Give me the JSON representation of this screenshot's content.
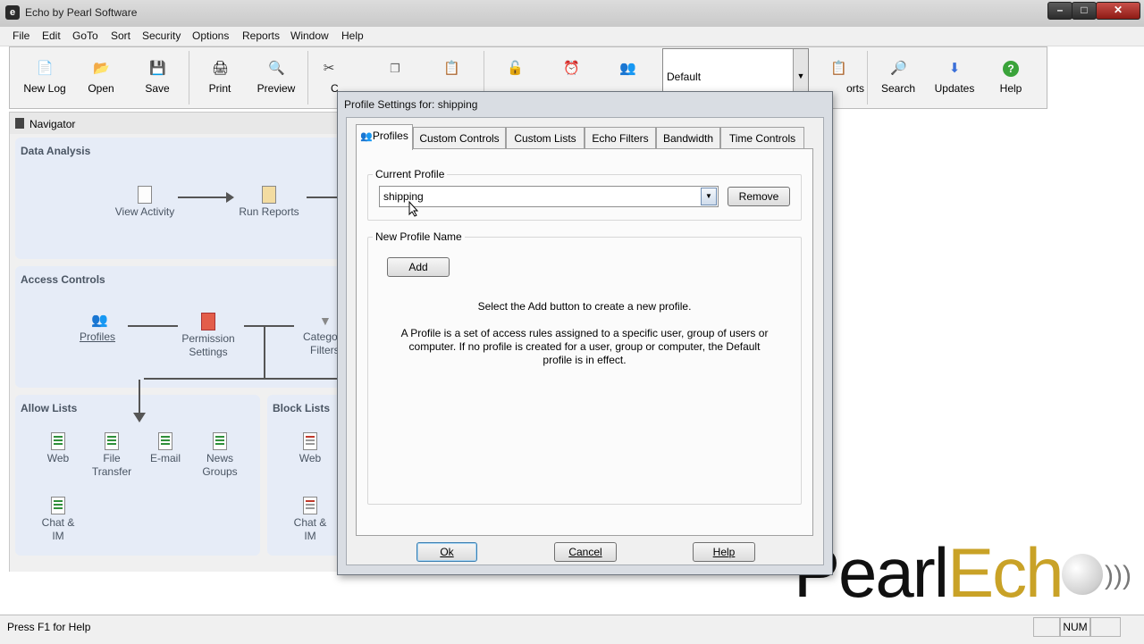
{
  "window": {
    "title": "Echo by Pearl Software",
    "app_icon_glyph": "e",
    "controls": [
      "–",
      "□",
      "✕"
    ]
  },
  "menu": [
    "File",
    "Edit",
    "GoTo",
    "Sort",
    "Security",
    "Options",
    "Reports",
    "Window",
    "Help"
  ],
  "toolbar": {
    "new_log": "New Log",
    "open": "Open",
    "save": "Save",
    "print": "Print",
    "preview": "Preview",
    "cut_partial": "C",
    "profile_combo_value": "Default",
    "reports_partial": "orts",
    "search": "Search",
    "updates": "Updates",
    "help": "Help"
  },
  "navigator": {
    "title": "Navigator",
    "data_analysis": {
      "title": "Data Analysis",
      "view_activity": "View Activity",
      "run_reports": "Run Reports"
    },
    "access_controls": {
      "title": "Access Controls",
      "profiles": "Profiles",
      "permission_settings_1": "Permission",
      "permission_settings_2": "Settings",
      "category_filters_1": "Categor",
      "category_filters_2": "Filters"
    },
    "allow_lists": {
      "title": "Allow Lists",
      "web": "Web",
      "file_transfer_1": "File",
      "file_transfer_2": "Transfer",
      "email": "E-mail",
      "news_groups_1": "News",
      "news_groups_2": "Groups",
      "chat_im_1": "Chat &",
      "chat_im_2": "IM"
    },
    "block_lists": {
      "title": "Block Lists",
      "web": "Web",
      "chat_im_1": "Chat &",
      "chat_im_2": "IM"
    }
  },
  "dialog": {
    "title": "Profile Settings for: shipping",
    "tabs": [
      "Profiles",
      "Custom Controls",
      "Custom Lists",
      "Echo Filters",
      "Bandwidth",
      "Time Controls"
    ],
    "current_profile_label": "Current Profile",
    "current_profile_value": "shipping",
    "remove_button": "Remove",
    "new_profile_label": "New Profile Name",
    "add_button": "Add",
    "instruction": "Select the Add button to create a new profile.",
    "description_1": "A Profile is a set of access rules assigned to a specific user, group of users or",
    "description_2": "computer. If no profile is created for a user, group or computer, the Default",
    "description_3": "profile is in effect.",
    "ok_button": "Ok",
    "cancel_button": "Cancel",
    "help_button": "Help"
  },
  "status": {
    "hint": "Press F1 for Help",
    "num": "NUM"
  },
  "logo": {
    "pearl": "Pearl",
    "ech": "Ech"
  },
  "colors": {
    "panel_bg": "#e6ecf7",
    "panel_text": "#4a5563",
    "logo_gold": "#c9a227"
  }
}
